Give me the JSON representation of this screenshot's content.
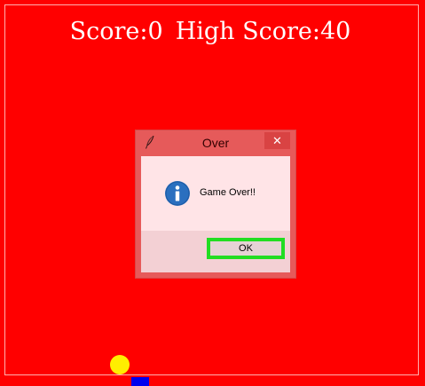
{
  "game": {
    "score_text": "Score:0",
    "high_score_text": "High Score:40",
    "background_color": "#ff0000",
    "ball_color": "#ffee00",
    "paddle_color": "#0000ee"
  },
  "dialog": {
    "title": "Over",
    "close_label": "✕",
    "message": "Game Over!!",
    "ok_label": "OK",
    "title_icon": "feather-icon",
    "message_icon": "info-icon",
    "focus_color": "#22dd22"
  }
}
